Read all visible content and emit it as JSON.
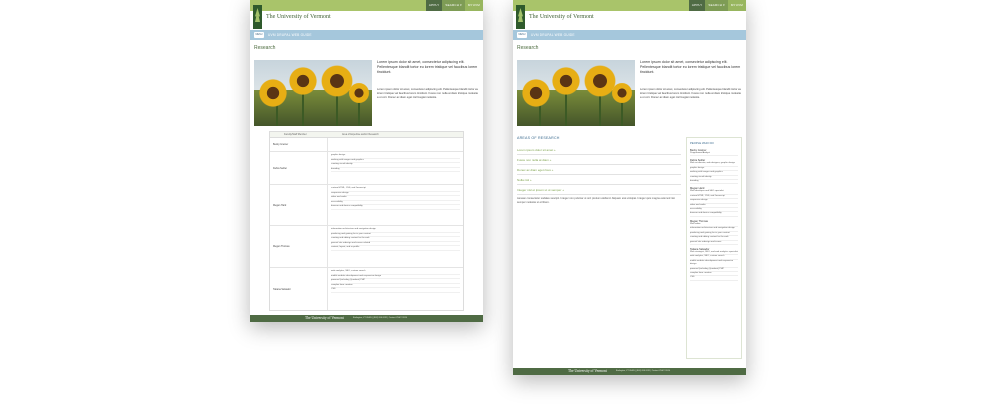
{
  "colors": {
    "green_bar": "#a9c46a",
    "dark_green": "#4f6b44",
    "blue_bar": "#a5c7dc",
    "link_green": "#7da24c"
  },
  "nav": {
    "apply": "APPLY",
    "search": "SEARCH ▾",
    "more": "MYUVM"
  },
  "logo": {
    "title": "The University of Vermont",
    "icon": "tree-logo-icon"
  },
  "guide": {
    "button": "MENU",
    "text": "UVM DRUPAL WEB GUIDE"
  },
  "page_title": "Research",
  "intro": {
    "lead": "Lorem ipsum dolor sit amet, consectetur adipiscing elit. Pellentesque blandit tortor eu lorem tristique vel faucibus lorem tincidunt.",
    "body": "Lorem ipsum dolor sit amet, consectetur adipiscing elit. Pellentesque blandit tortor eu lorem tristique vel faucibus lorem tincidunt. Fusce non nulla at diam tristique molestie a ut orci. Donec ac diam eget nisl feugiat molestie."
  },
  "staff_table": {
    "headers": [
      "Faculty/Staff Member",
      "Area of Expertise and/or Research"
    ],
    "rows": [
      {
        "name": "Becky Greiner",
        "skills": []
      },
      {
        "name": "Debra Seitler",
        "skills": [
          "graphic design",
          "working with images and graphics",
          "creating visual identity",
          "branding"
        ]
      },
      {
        "name": "Megan Hard",
        "skills": [
          "custom HTML, CSS, and Javascript",
          "responsive design",
          "video and audio",
          "accessibility",
          "browser and device compatibility"
        ]
      },
      {
        "name": "Megan Thomas",
        "skills": [
          "information architecture and navigation design",
          "producing and gaining for in your content",
          "creating and editing content for the web",
          "general site redesign and course related",
          "content, layout, and re-profile"
        ]
      },
      {
        "name": "Tatiana Salvador",
        "skills": [
          "web analytics, SEO, custom search",
          "mobile website development and responsive design",
          "powered (including Quadrant) PHP",
          "complex form creation",
          "CSS"
        ]
      }
    ]
  },
  "footer": {
    "brand": "The University of Vermont",
    "address": "Burlington, VT 05405  |  (802) 656-3131  |  Contact UVM ©2014"
  },
  "research": {
    "areas_title": "AREAS OF RESEARCH",
    "accordion": [
      "Lorem ipsum dolor sit amet  +",
      "Fusce non nulla at diam  +",
      "Donec ac diam eget risus  +",
      "Nulla nisl  +",
      "Integer nisl et ipsum ut ut semper  +"
    ],
    "accordion_body": "Aenean consectetur sodales suscipit. Integer non pulvinar ut orci pretium eleifend. Aliquam erat volutpat. Integer quis magna euismod nisi semper molestie ut et libero."
  },
  "sidebar": {
    "title": "PEOPLE WHO DO",
    "people": [
      {
        "name": "Becky Greiner",
        "items": [
          "Programmer/Analyst"
        ]
      },
      {
        "name": "Debra Seitler",
        "items": [
          "Web art director, web designer, graphic design",
          "graphic design",
          "working with images and graphics",
          "creating visual identity",
          "branding"
        ]
      },
      {
        "name": "Megan Hard",
        "items": [
          "Web developer and SEO specialist",
          "custom HTML, CSS, and Javascript",
          "responsive design",
          "video and audio",
          "accessibility",
          "browser and device compatibility"
        ]
      },
      {
        "name": "Megan Thomas",
        "items": [
          "Web editor",
          "information architecture and navigation design",
          "producing and gaining for in your content",
          "creating and editing content for the web",
          "general site redesign and issues"
        ]
      },
      {
        "name": "Tatiana Salvador",
        "items": [
          "Web strategist, SEO, and web analytics specialist",
          "web analytics, SEO, custom search",
          "mobile website development and responsive design",
          "powered (including Quadrant) PHP",
          "complex form creation",
          "CSS"
        ]
      }
    ]
  }
}
